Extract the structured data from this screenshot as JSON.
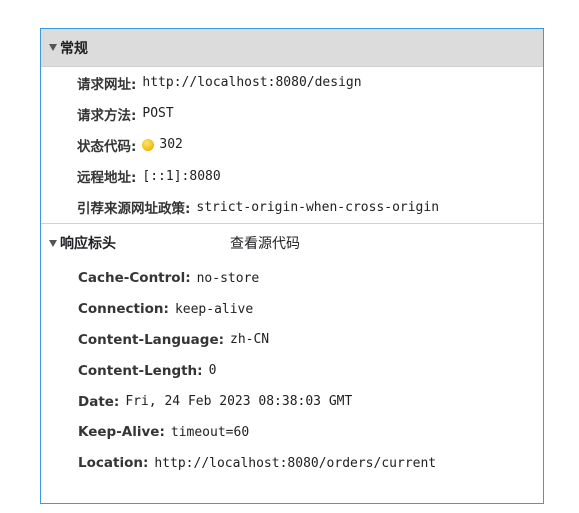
{
  "general": {
    "title": "常规",
    "rows": [
      {
        "key": "请求网址:",
        "value": "http://localhost:8080/design"
      },
      {
        "key": "请求方法:",
        "value": "POST"
      },
      {
        "key": "状态代码:",
        "value": "302"
      },
      {
        "key": "远程地址:",
        "value": "[::1]:8080"
      },
      {
        "key": "引荐来源网址政策:",
        "value": "strict-origin-when-cross-origin"
      }
    ]
  },
  "response_headers": {
    "title": "响应标头",
    "view_source": "查看源代码",
    "rows": [
      {
        "key": "Cache-Control:",
        "value": "no-store"
      },
      {
        "key": "Connection:",
        "value": "keep-alive"
      },
      {
        "key": "Content-Language:",
        "value": "zh-CN"
      },
      {
        "key": "Content-Length:",
        "value": "0"
      },
      {
        "key": "Date:",
        "value": "Fri, 24 Feb 2023 08:38:03 GMT"
      },
      {
        "key": "Keep-Alive:",
        "value": "timeout=60"
      },
      {
        "key": "Location:",
        "value": "http://localhost:8080/orders/current"
      }
    ]
  },
  "colors": {
    "panel_border": "#3c9adf",
    "general_header_bg": "#dcdcdc",
    "status_dot": "#f3bf14"
  },
  "icons": {
    "expand": "triangle-down-icon",
    "status": "status-dot-icon"
  }
}
